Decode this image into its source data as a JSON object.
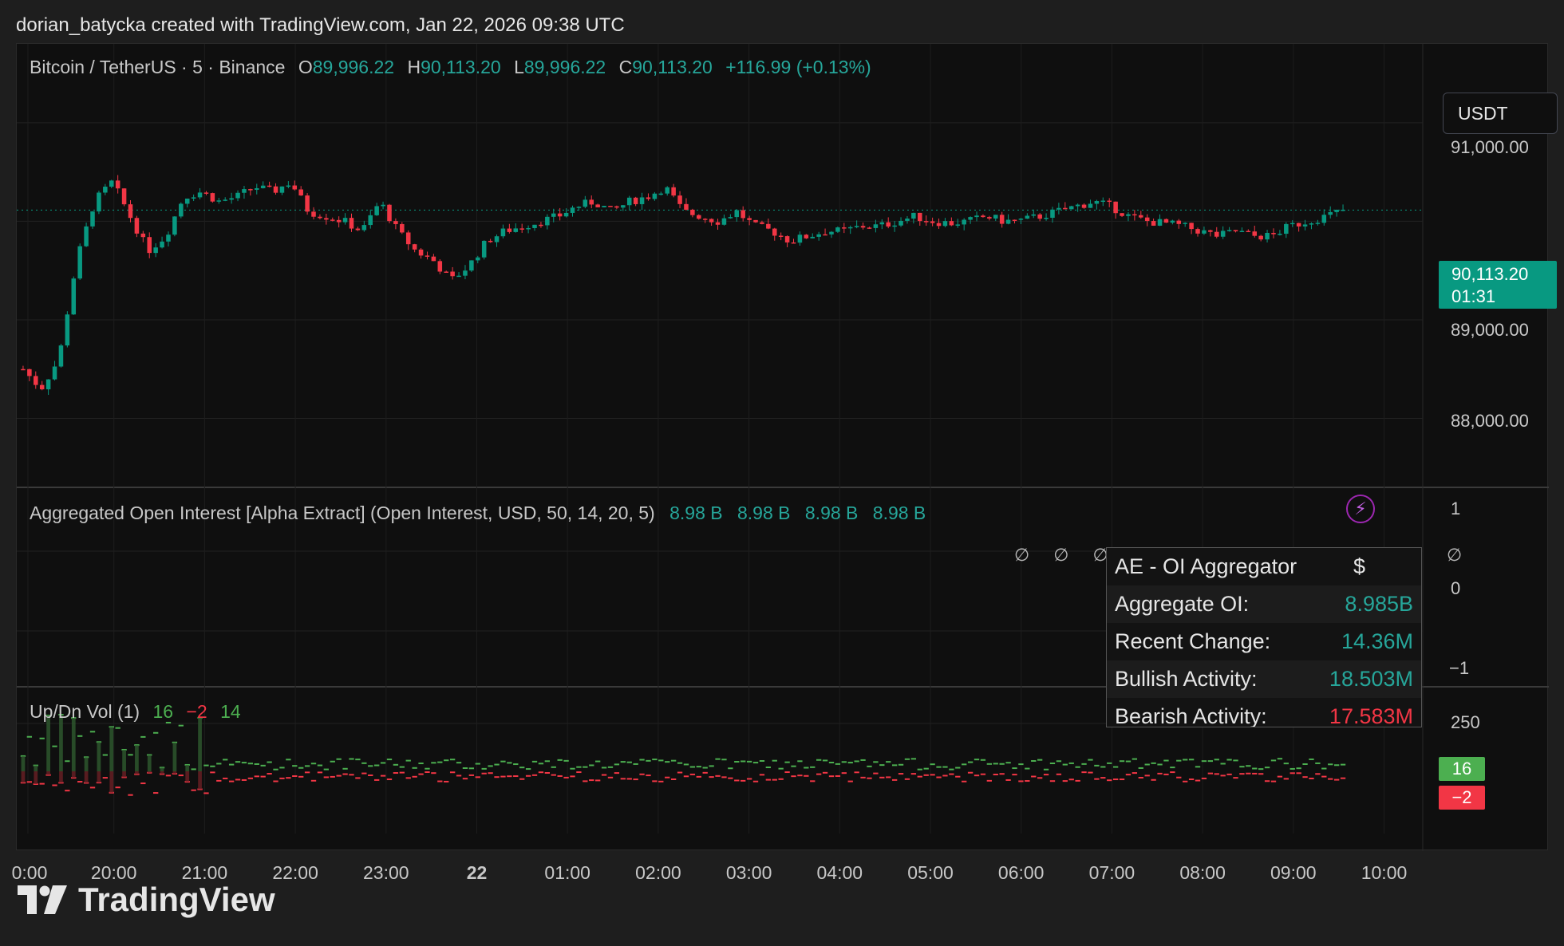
{
  "header": {
    "attribution": "dorian_batycka created with TradingView.com, Jan 22, 2026 09:38 UTC"
  },
  "symbol_legend": {
    "symbol": "Bitcoin / TetherUS · 5 · Binance",
    "o_label": "O",
    "o_value": "89,996.22",
    "h_label": "H",
    "h_value": "90,113.20",
    "l_label": "L",
    "l_value": "89,996.22",
    "c_label": "C",
    "c_value": "90,113.20",
    "change": "+116.99 (+0.13%)"
  },
  "currency_button": "USDT",
  "last_price": {
    "price": "90,113.20",
    "countdown": "01:31"
  },
  "price_axis": [
    "91,000.00",
    "89,000.00",
    "88,000.00"
  ],
  "oi_legend": {
    "title": "Aggregated Open Interest [Alpha Extract] (Open Interest, USD, 50, 14, 20, 5)",
    "values": [
      "8.98 B",
      "8.98 B",
      "8.98 B",
      "8.98 B"
    ],
    "nulls": "∅ ∅ ∅ ∅ ∅ ∅ ∅ ∅ ∅ ∅ ∅ ∅"
  },
  "oi_axis": [
    "1",
    "0",
    "−1"
  ],
  "oi_table": {
    "header_left": "AE - OI Aggregator",
    "header_right": "$",
    "rows": [
      {
        "label": "Aggregate OI:",
        "value": "8.985B",
        "tone": "green"
      },
      {
        "label": "Recent Change:",
        "value": "14.36M",
        "tone": "green"
      },
      {
        "label": "Bullish Activity:",
        "value": "18.503M",
        "tone": "green"
      },
      {
        "label": "Bearish Activity:",
        "value": "17.583M",
        "tone": "red"
      }
    ]
  },
  "vol_legend": {
    "title": "Up/Dn Vol (1)",
    "up": "16",
    "down": "−2",
    "net": "14"
  },
  "vol_axis": [
    "250"
  ],
  "vol_tags": {
    "up": "16",
    "down": "−2"
  },
  "time_axis": [
    "0:00",
    "20:00",
    "21:00",
    "22:00",
    "23:00",
    "22",
    "01:00",
    "02:00",
    "03:00",
    "04:00",
    "05:00",
    "06:00",
    "07:00",
    "08:00",
    "09:00",
    "10:00"
  ],
  "footer": {
    "brand": "TradingView"
  },
  "colors": {
    "up": "#089981",
    "down": "#f23645",
    "vol_up": "#4caf50",
    "vol_dn": "#f23645",
    "background": "#0f0f0f"
  },
  "chart_data": {
    "type": "candlestick",
    "symbol": "Bitcoin / TetherUS",
    "interval": "5",
    "ylim": [
      87300,
      91800
    ],
    "last": 90113.2,
    "x_ticks": [
      "0:00",
      "20:00",
      "21:00",
      "22:00",
      "23:00",
      "22",
      "01:00",
      "02:00",
      "03:00",
      "04:00",
      "05:00",
      "06:00",
      "07:00",
      "08:00",
      "09:00",
      "10:00"
    ],
    "close_path": [
      88500,
      88300,
      88600,
      89600,
      90200,
      90400,
      90050,
      89700,
      89850,
      90250,
      90300,
      90200,
      90250,
      90350,
      90300,
      90400,
      90100,
      90050,
      90000,
      89900,
      90200,
      89900,
      89700,
      89600,
      89400,
      89550,
      89800,
      89900,
      89950,
      90000,
      90050,
      90150,
      90200,
      90100,
      90200,
      90250,
      90350,
      90100,
      90050,
      90000,
      90100,
      89950,
      89900,
      89800,
      89850,
      89900,
      89900,
      89950,
      89950,
      90000,
      90050,
      90000,
      89980,
      90000,
      90050,
      90000,
      90010,
      90050,
      90100,
      90150,
      90200,
      90150,
      90050,
      90000,
      89980,
      89950,
      89900,
      89850,
      89900,
      89850,
      89850,
      89950,
      90000,
      90050,
      90113
    ]
  }
}
